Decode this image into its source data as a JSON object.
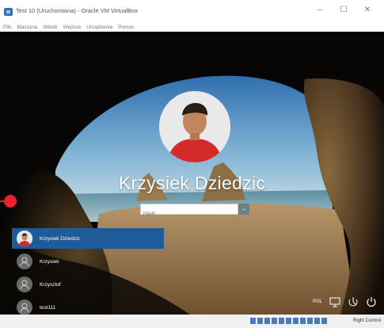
{
  "window": {
    "title": "Test 10 (Uruchomiona) - Oracle VM VirtualBox",
    "controls": {
      "minimize": "–",
      "maximize": "☐",
      "close": "✕"
    }
  },
  "menu": [
    "Plik",
    "Maszyna",
    "Widok",
    "Wejście",
    "Urządzenia",
    "Pomoc"
  ],
  "lockscreen": {
    "user_name": "Krzysiek Dziedzic",
    "password_placeholder": "Hasło",
    "submit_glyph": "→"
  },
  "users": [
    {
      "name": "Krzysiek Dziedzic",
      "selected": true,
      "photo": true
    },
    {
      "name": "Krzysiek",
      "selected": false,
      "photo": false
    },
    {
      "name": "Krzysztof",
      "selected": false,
      "photo": false
    },
    {
      "name": "test111",
      "selected": false,
      "photo": false
    }
  ],
  "tray": {
    "language": "POL",
    "icons": [
      "network-icon",
      "ease-of-access-icon",
      "power-icon"
    ]
  },
  "statusbar": {
    "host_key": "Right Control"
  },
  "colors": {
    "selected_user": "#1e5b9a",
    "annotation": "#e8222a"
  }
}
